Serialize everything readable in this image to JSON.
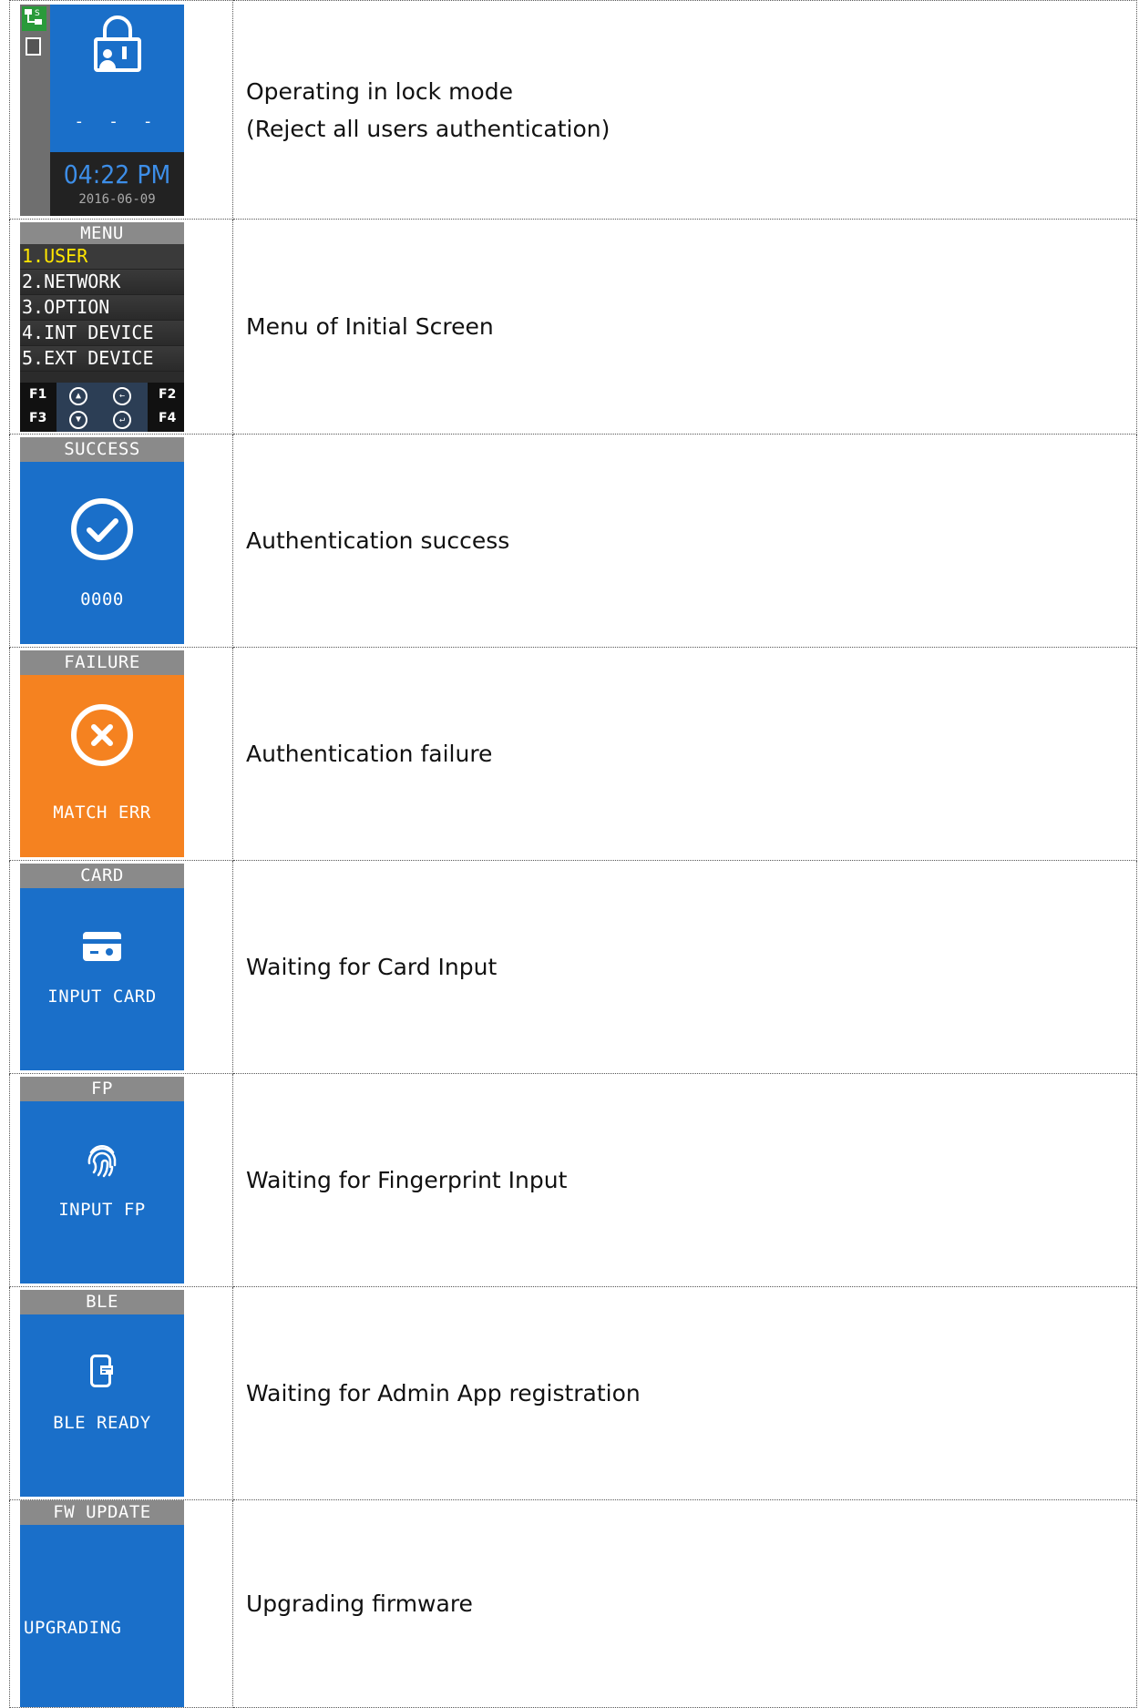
{
  "rows": [
    {
      "screen": {
        "time": "04:22 PM",
        "date": "2016-06-09",
        "placeholder": "- - -"
      },
      "description_line1": "Operating in lock mode",
      "description_line2": "(Reject all users authentication)"
    },
    {
      "screen": {
        "header": "MENU",
        "items": [
          "1.USER",
          "2.NETWORK",
          "3.OPTION",
          "4.INT DEVICE",
          "5.EXT DEVICE"
        ],
        "fkeys": [
          "F1",
          "F2",
          "F3",
          "F4"
        ]
      },
      "description": "Menu of Initial Screen"
    },
    {
      "screen": {
        "header": "SUCCESS",
        "label": "0000"
      },
      "description": "Authentication success"
    },
    {
      "screen": {
        "header": "FAILURE",
        "label": "MATCH ERR"
      },
      "description": "Authentication failure"
    },
    {
      "screen": {
        "header": "CARD",
        "label": "INPUT CARD"
      },
      "description": "Waiting for Card Input"
    },
    {
      "screen": {
        "header": "FP",
        "label": "INPUT FP"
      },
      "description": "Waiting for Fingerprint Input"
    },
    {
      "screen": {
        "header": "BLE",
        "label": "BLE READY"
      },
      "description": "Waiting for Admin App registration"
    },
    {
      "screen": {
        "header": "FW UPDATE",
        "label": "UPGRADING"
      },
      "description": "Upgrading firmware"
    }
  ],
  "colors": {
    "screen_blue": "#1a6fc9",
    "screen_orange": "#f58220",
    "header_gray": "#8a8a8a",
    "menu_selected": "#ffe600"
  }
}
